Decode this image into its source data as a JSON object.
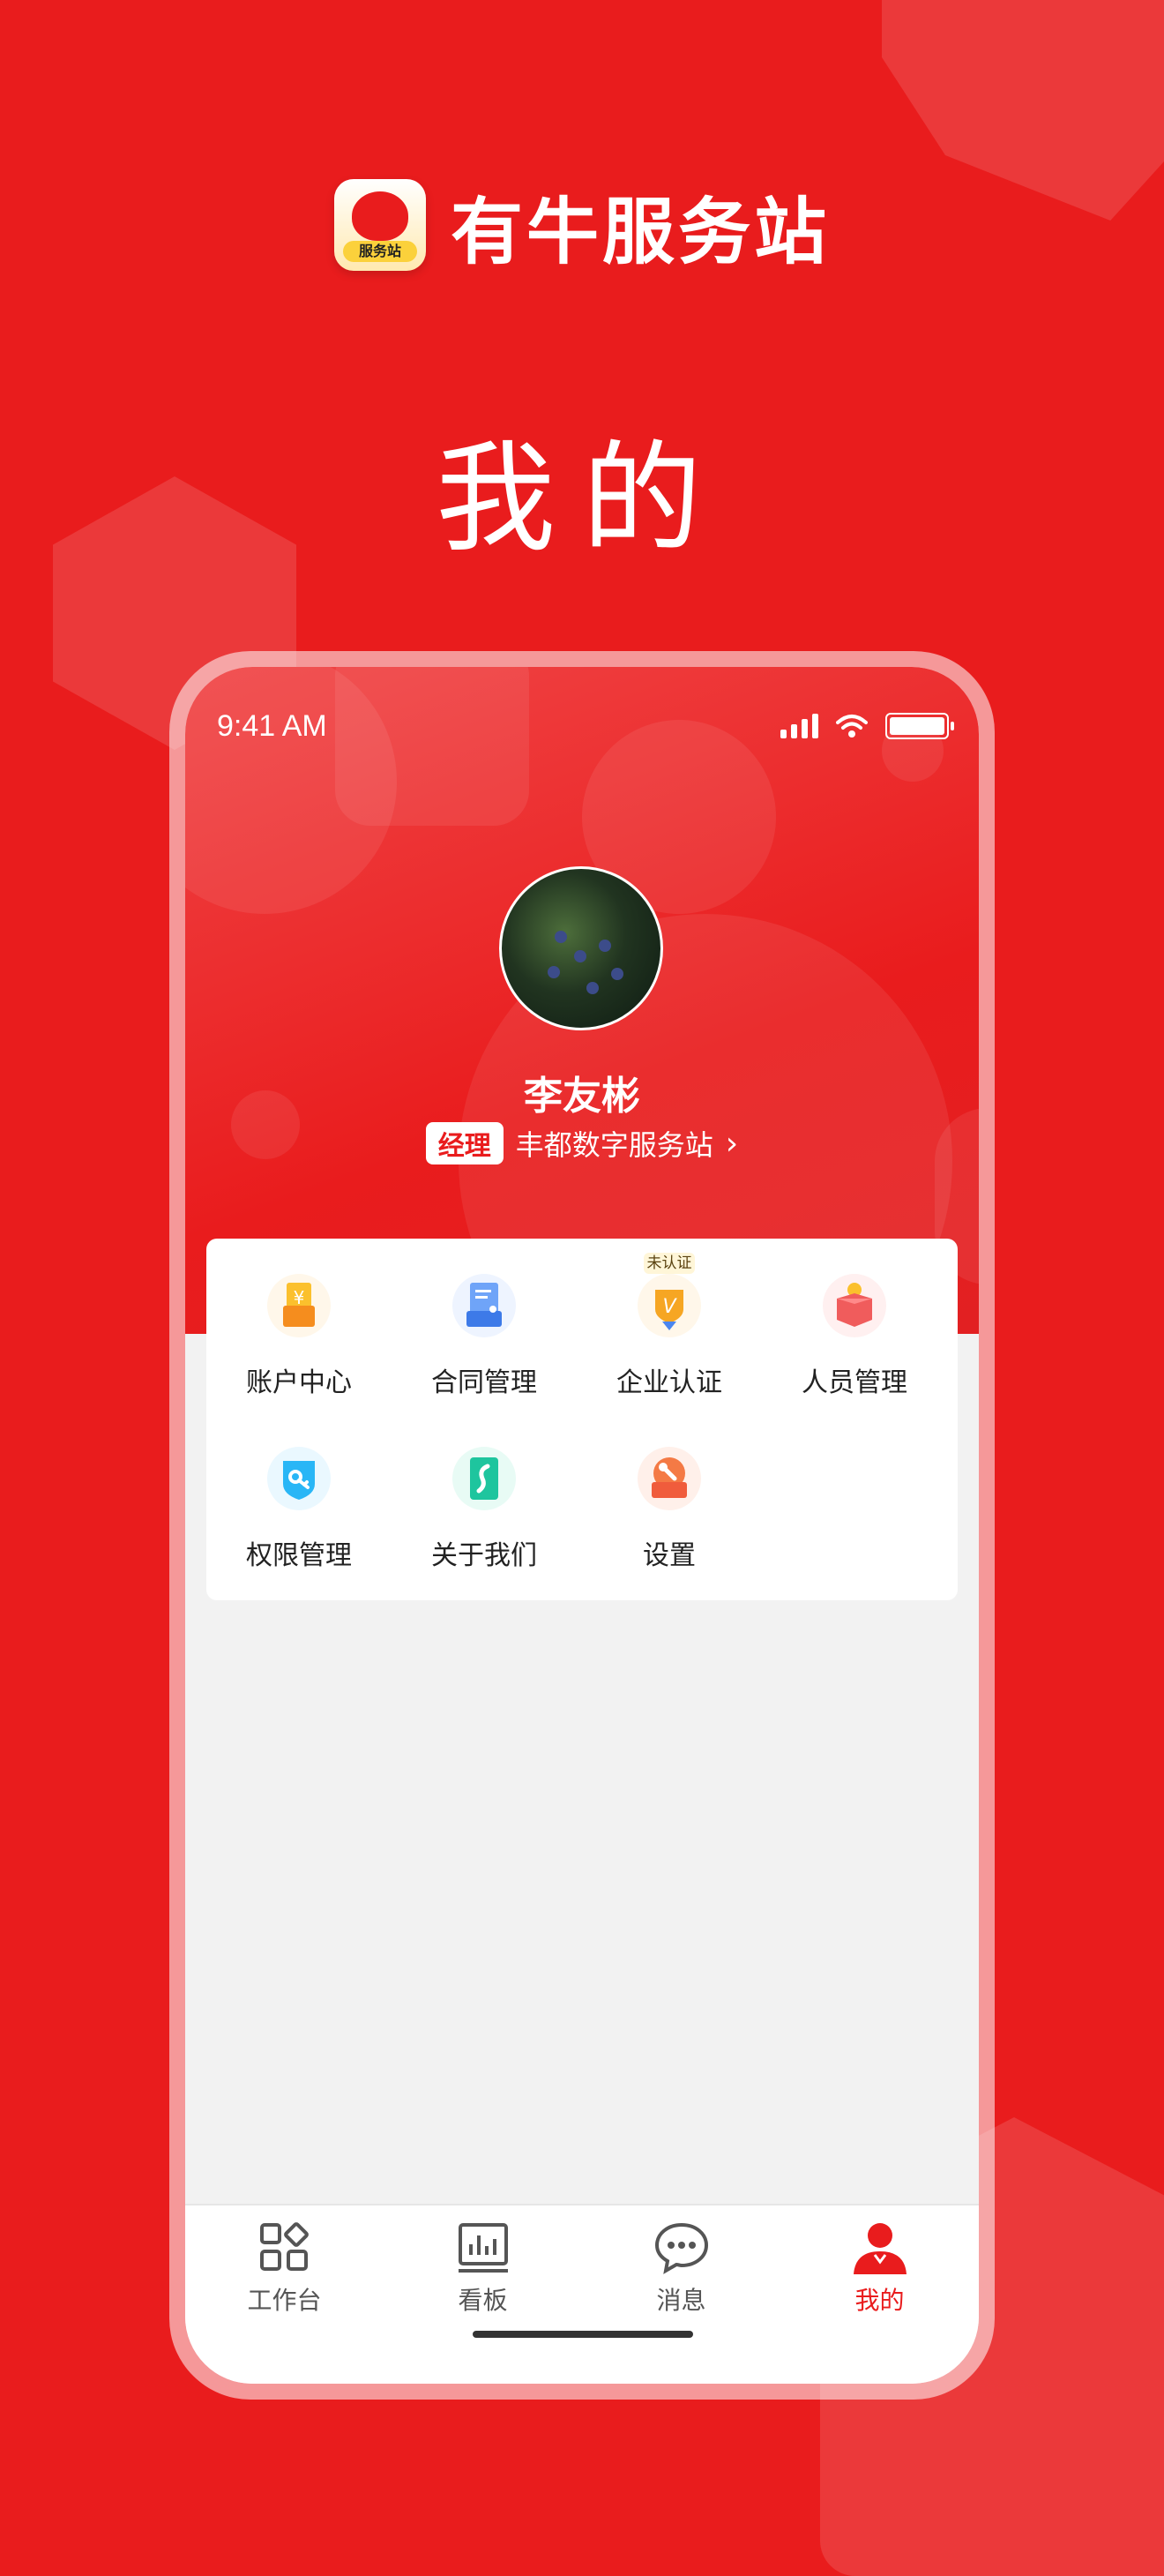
{
  "brand": {
    "name": "有牛服务站",
    "icon_label": "服务站"
  },
  "page_heading": "我的",
  "status_bar": {
    "time": "9:41 AM"
  },
  "profile": {
    "name": "李友彬",
    "role": "经理",
    "organization": "丰都数字服务站"
  },
  "menu": [
    {
      "label": "账户中心",
      "icon": "account-wallet-icon",
      "color": "#f7a62b"
    },
    {
      "label": "合同管理",
      "icon": "contract-document-icon",
      "color": "#4a86f0"
    },
    {
      "label": "企业认证",
      "icon": "enterprise-verify-icon",
      "color": "#f3a133",
      "tag": "未认证"
    },
    {
      "label": "人员管理",
      "icon": "staff-box-icon",
      "color": "#f04e4e"
    },
    {
      "label": "权限管理",
      "icon": "permission-key-icon",
      "color": "#22b4e8"
    },
    {
      "label": "关于我们",
      "icon": "about-us-icon",
      "color": "#19c29a"
    },
    {
      "label": "设置",
      "icon": "settings-wrench-icon",
      "color": "#f06a3a"
    }
  ],
  "tabs": [
    {
      "label": "工作台",
      "icon": "workbench-grid-icon"
    },
    {
      "label": "看板",
      "icon": "dashboard-chart-icon"
    },
    {
      "label": "消息",
      "icon": "message-bubble-icon"
    },
    {
      "label": "我的",
      "icon": "profile-person-icon",
      "active": true
    }
  ],
  "colors": {
    "primary": "#e91c1d",
    "badge_bg": "#ffffff"
  }
}
